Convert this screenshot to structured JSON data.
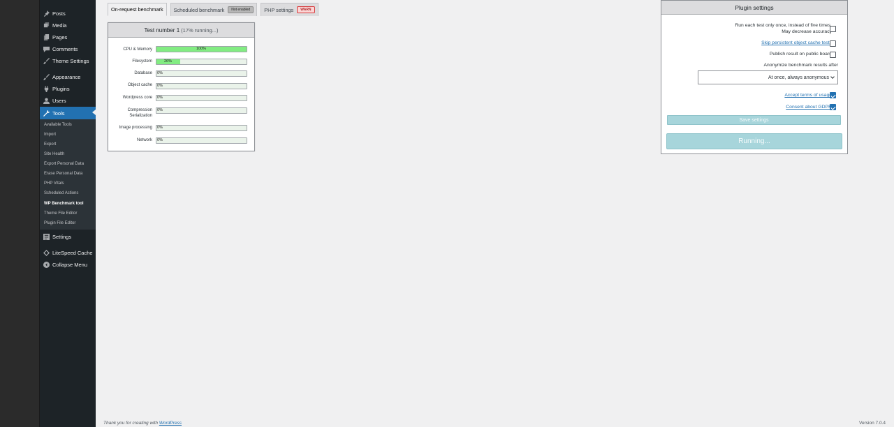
{
  "sidebar": {
    "items": [
      {
        "label": "Posts",
        "icon": "pin-icon"
      },
      {
        "label": "Media",
        "icon": "media-icon"
      },
      {
        "label": "Pages",
        "icon": "pages-icon"
      },
      {
        "label": "Comments",
        "icon": "comments-icon"
      },
      {
        "label": "Theme Settings",
        "icon": "brush-icon"
      },
      {
        "label": "Appearance",
        "icon": "appearance-icon"
      },
      {
        "label": "Plugins",
        "icon": "plugins-icon"
      },
      {
        "label": "Users",
        "icon": "users-icon"
      },
      {
        "label": "Tools",
        "icon": "tools-icon"
      },
      {
        "label": "Settings",
        "icon": "settings-icon"
      },
      {
        "label": "LiteSpeed Cache",
        "icon": "litespeed-icon"
      },
      {
        "label": "Collapse Menu",
        "icon": "collapse-icon"
      }
    ],
    "submenu": [
      "Available Tools",
      "Import",
      "Export",
      "Site Health",
      "Export Personal Data",
      "Erase Personal Data",
      "PHP Vitals",
      "Scheduled Actions",
      "WP Benchmark tool",
      "Theme File Editor",
      "Plugin File Editor"
    ]
  },
  "tabs": {
    "on_request": "On-request benchmark",
    "scheduled": "Scheduled benchmark",
    "scheduled_badge": "Not enabled",
    "php": "PHP settings",
    "php_badge": "WARN"
  },
  "test": {
    "title": "Test number 1",
    "status": "(17% running...)",
    "rows": [
      {
        "label": "CPU & Memory",
        "percent": 100,
        "text": "100%"
      },
      {
        "label": "Filesystem",
        "percent": 26,
        "text": "26%"
      },
      {
        "label": "Database",
        "percent": 0,
        "text": "0%"
      },
      {
        "label": "Object cache",
        "percent": 0,
        "text": "0%"
      },
      {
        "label": "Wordpress core",
        "percent": 0,
        "text": "0%"
      },
      {
        "label": "Compression",
        "label2": "Serialization",
        "percent": 0,
        "text": "0%"
      },
      {
        "label": "Image processing",
        "percent": 0,
        "text": "0%"
      },
      {
        "label": "Network",
        "percent": 0,
        "text": "0%"
      }
    ]
  },
  "settings": {
    "title": "Plugin settings",
    "run_once_line1": "Run each test only once, instead of five times.",
    "run_once_line2": "May decrease accuracy",
    "skip_cache": "Skip persistent object cache tests",
    "publish": "Publish result on public board",
    "anonymize": "Anonymize benchmark results after",
    "anonymize_value": "At once, always anonymous",
    "accept_terms": "Accept terms of usage",
    "consent_gdpr": "Consent about GDPR",
    "save": "Save settings",
    "run": "Running..."
  },
  "footer": {
    "thanks": "Thank you for creating with",
    "wp_link": "WordPress",
    "version": "Version 7.0.4"
  },
  "colors": {
    "accent": "#2271b1",
    "sidebar_bg": "#1d2327",
    "progress_fill": "#82ec82",
    "button_disabled": "#a7d5db",
    "warn": "#d63638"
  }
}
